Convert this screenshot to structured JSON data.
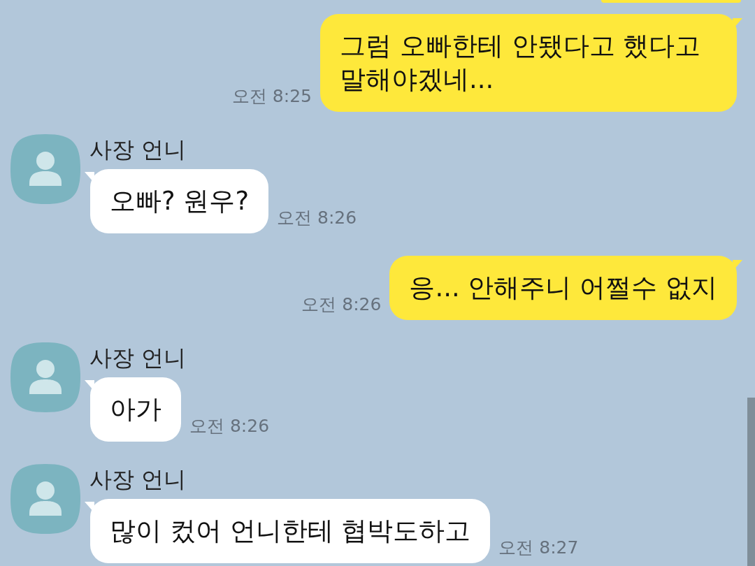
{
  "messages": [
    {
      "kind": "sent-cut"
    },
    {
      "kind": "sent",
      "text": "그럼 오빠한테 안됐다고 했다고 말해야겠네...",
      "time": "오전 8:25"
    },
    {
      "kind": "received",
      "sender": "사장 언니",
      "text": "오빠? 원우?",
      "time": "오전 8:26"
    },
    {
      "kind": "sent",
      "text": "응... 안해주니 어쩔수 없지",
      "time": "오전 8:26"
    },
    {
      "kind": "received",
      "sender": "사장 언니",
      "text": "아가",
      "time": "오전 8:26"
    },
    {
      "kind": "received",
      "sender": "사장 언니",
      "text": "많이 컸어 언니한테 협박도하고",
      "time": "오전 8:27"
    }
  ]
}
